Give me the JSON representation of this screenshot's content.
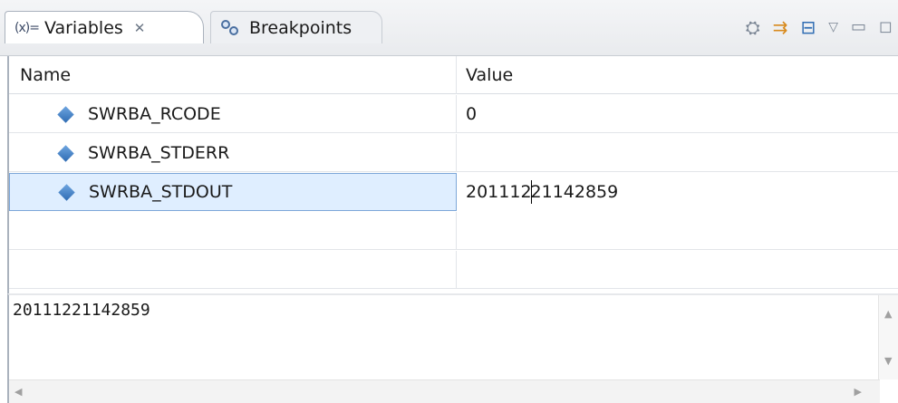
{
  "tabs": [
    {
      "icon": "(x)=",
      "label": "Variables",
      "close": "✕",
      "active": true
    },
    {
      "label": "Breakpoints",
      "active": false
    }
  ],
  "columns": {
    "name": "Name",
    "value": "Value"
  },
  "rows": [
    {
      "name": "SWRBA_RCODE",
      "value": "0"
    },
    {
      "name": "SWRBA_STDERR",
      "value": ""
    },
    {
      "name": "SWRBA_STDOUT",
      "value_before_caret": "201112",
      "value_after_caret": "21142859"
    }
  ],
  "detail": {
    "text": "20111221142859"
  },
  "colors": {
    "selection": "#dfeeff",
    "selection_border": "#7da7d9",
    "accent": "#2f6cb3"
  }
}
